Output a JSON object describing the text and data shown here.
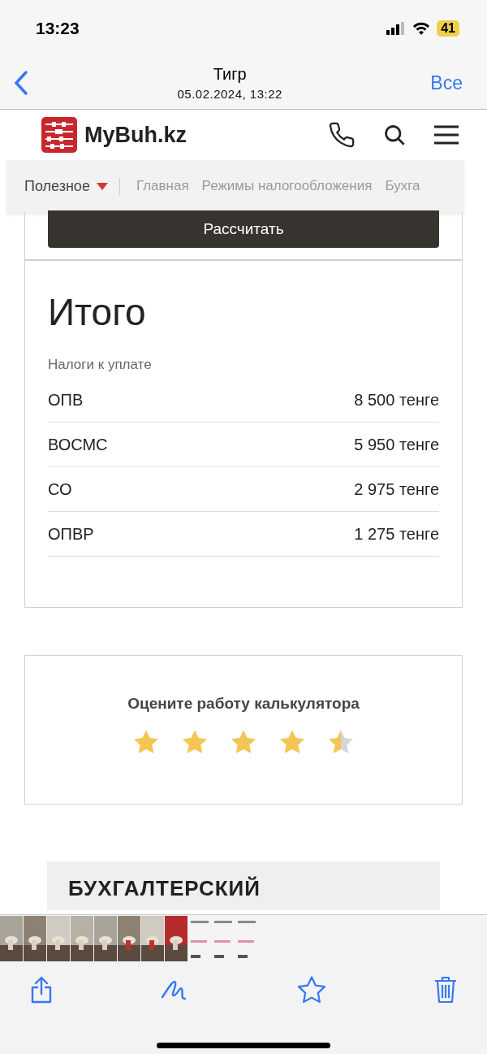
{
  "status_bar": {
    "time": "13:23",
    "battery": "41"
  },
  "nav": {
    "title": "Тигр",
    "subtitle": "05.02.2024, 13:22",
    "action": "Все"
  },
  "site": {
    "logo": "MyBuh.kz",
    "menu": [
      {
        "label": "Полезное",
        "kind": "dropdown"
      },
      {
        "label": "Главная",
        "kind": "link"
      },
      {
        "label": "Режимы налогообложения",
        "kind": "link"
      },
      {
        "label": "Бухга",
        "kind": "link"
      }
    ]
  },
  "calc_button": "Рассчитать",
  "result": {
    "title": "Итого",
    "subtitle": "Налоги к уплате",
    "rows": [
      {
        "name": "ОПВ",
        "value": "8 500 тенге"
      },
      {
        "name": "ВОСМС",
        "value": "5 950 тенге"
      },
      {
        "name": "СО",
        "value": "2 975 тенге"
      },
      {
        "name": "ОПВР",
        "value": "1 275 тенге"
      }
    ]
  },
  "rating": {
    "title": "Оцените работу калькулятора",
    "stars": 4.5
  },
  "banner": {
    "title": "БУХГАЛТЕРСКИЙ"
  }
}
